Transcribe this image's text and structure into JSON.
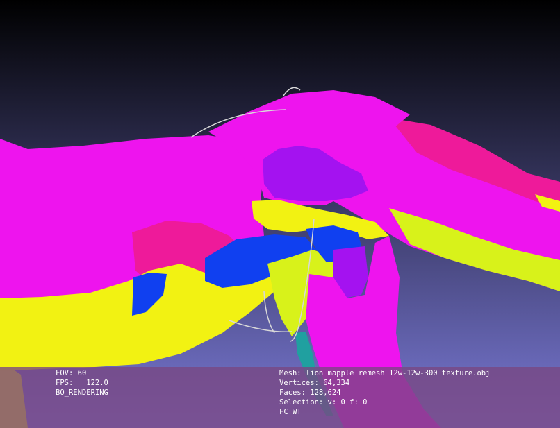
{
  "viewer": {
    "background": {
      "top": "#000000",
      "bottom": "#7a79d6"
    },
    "mesh_colors": {
      "magenta": "#ee14ee",
      "pink": "#ee1a9a",
      "purple": "#a412f0",
      "yellow": "#f2f212",
      "lime": "#d8f21a",
      "blue": "#1040f0",
      "trackball": "#d8d8d8"
    }
  },
  "hud": {
    "left": {
      "fov_label": "FOV:",
      "fov_value": "60",
      "fps_label": "FPS:",
      "fps_value": "122.0",
      "render_mode": "BO_RENDERING"
    },
    "right": {
      "mesh_label": "Mesh:",
      "mesh_value": "lion_mapple_remesh_12w-12w-300_texture.obj",
      "vertices_label": "Vertices:",
      "vertices_value": "64,334",
      "faces_label": "Faces:",
      "faces_value": "128,624",
      "selection_label": "Selection:",
      "selection_value": "v: 0 f: 0",
      "mode": "FC WT"
    }
  }
}
